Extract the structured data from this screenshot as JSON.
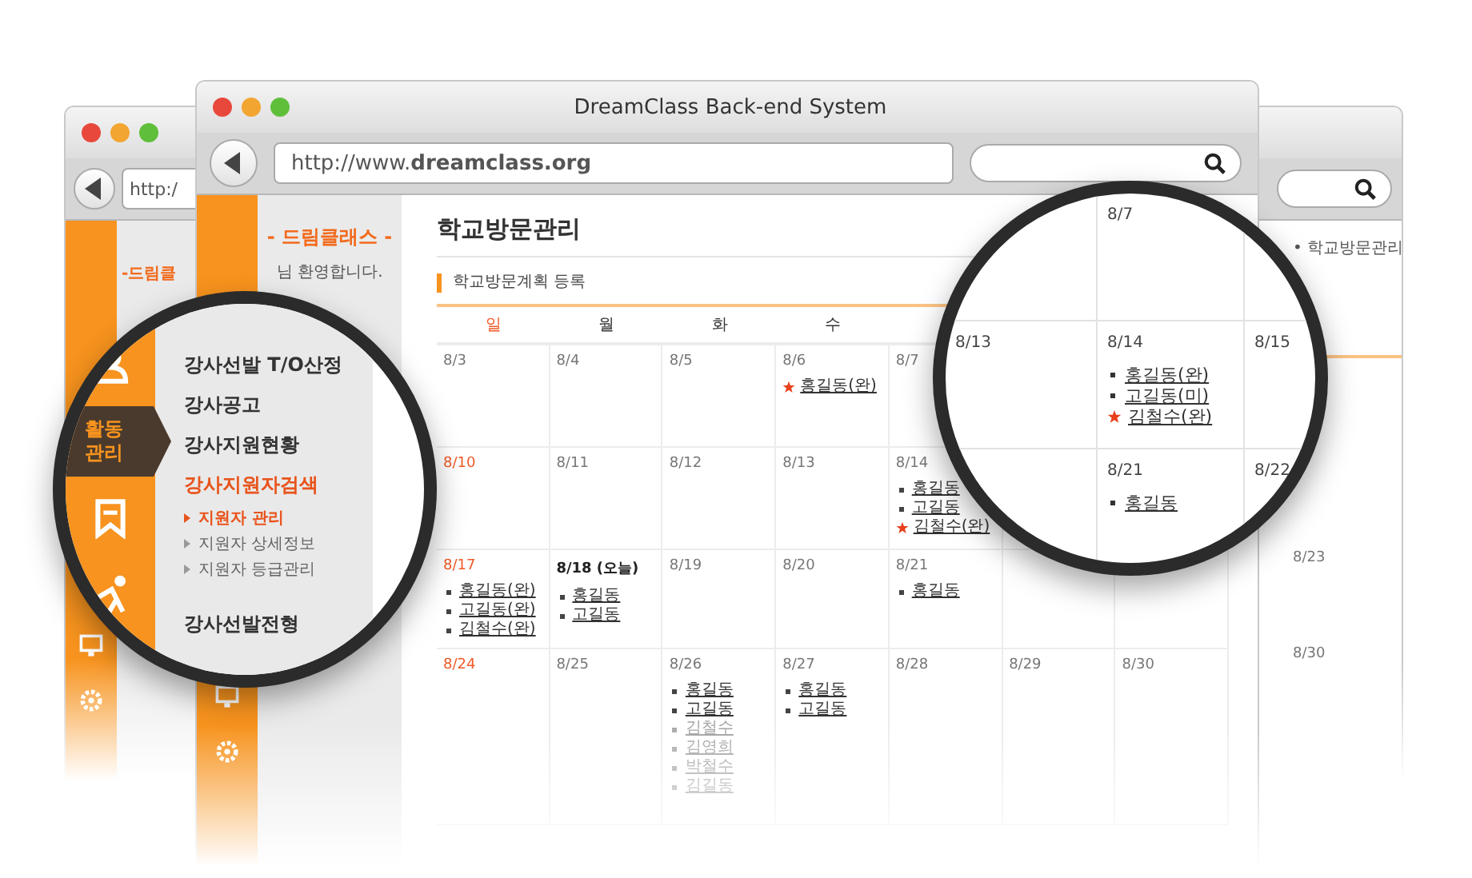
{
  "back_windows": {
    "left": {
      "url": "http:/",
      "logo": "-드림클"
    },
    "right": {
      "breadcrumb": "• 학교방문관리",
      "dates": [
        "8/23",
        "8/30"
      ]
    }
  },
  "window": {
    "title": "DreamClass Back-end System",
    "url": "http://www.**dreamclass.org**"
  },
  "sidebar": {
    "logo": "- 드림클래스 -",
    "welcome": "님 환영합니다."
  },
  "page": {
    "title": "학교방문관리",
    "section": "학교방문계획 등록"
  },
  "calendar": {
    "weekdays": [
      {
        "label": "일",
        "kind": "holiday"
      },
      {
        "label": "월",
        "kind": "normal"
      },
      {
        "label": "화",
        "kind": "normal"
      },
      {
        "label": "수",
        "kind": "normal"
      }
    ],
    "weeks": [
      [
        {
          "date": "8/3",
          "kind": "normal"
        },
        {
          "date": "8/4",
          "kind": "normal"
        },
        {
          "date": "8/5",
          "kind": "normal"
        },
        {
          "date": "8/6",
          "kind": "normal",
          "entries": [
            {
              "name": "홍길동(완)",
              "kind": "star"
            }
          ]
        },
        {
          "date": "8/7",
          "kind": "normal"
        }
      ],
      [
        {
          "date": "8/10",
          "kind": "holiday"
        },
        {
          "date": "8/11",
          "kind": "normal"
        },
        {
          "date": "8/12",
          "kind": "normal"
        },
        {
          "date": "8/13",
          "kind": "normal"
        },
        {
          "date": "8/14",
          "kind": "normal",
          "entries": [
            {
              "name": "홍길동",
              "kind": "plain"
            },
            {
              "name": "고길동",
              "kind": "plain"
            },
            {
              "name": "김철수(완)",
              "kind": "star"
            }
          ]
        }
      ],
      [
        {
          "date": "8/17",
          "kind": "holiday",
          "entries": [
            {
              "name": "홍길동(완)",
              "kind": "plain"
            },
            {
              "name": "고길동(완)",
              "kind": "plain"
            },
            {
              "name": "김철수(완)",
              "kind": "plain"
            }
          ]
        },
        {
          "date": "8/18 (오늘)",
          "kind": "today",
          "entries": [
            {
              "name": "홍길동",
              "kind": "plain"
            },
            {
              "name": "고길동",
              "kind": "plain"
            }
          ]
        },
        {
          "date": "8/19",
          "kind": "normal"
        },
        {
          "date": "8/20",
          "kind": "normal"
        },
        {
          "date": "8/21",
          "kind": "normal",
          "entries": [
            {
              "name": "홍길동",
              "kind": "plain"
            }
          ]
        }
      ],
      [
        {
          "date": "8/24",
          "kind": "holiday"
        },
        {
          "date": "8/25",
          "kind": "normal"
        },
        {
          "date": "8/26",
          "kind": "normal",
          "entries": [
            {
              "name": "홍길동",
              "kind": "plain"
            },
            {
              "name": "고길동",
              "kind": "plain"
            },
            {
              "name": "김철수",
              "kind": "faded"
            },
            {
              "name": "김영희",
              "kind": "faded"
            },
            {
              "name": "박철수",
              "kind": "faded"
            },
            {
              "name": "김길동",
              "kind": "faded"
            }
          ]
        },
        {
          "date": "8/27",
          "kind": "normal",
          "entries": [
            {
              "name": "홍길동",
              "kind": "plain"
            },
            {
              "name": "고길동",
              "kind": "plain"
            }
          ]
        },
        {
          "date": "8/28",
          "kind": "normal"
        },
        {
          "date": "8/29",
          "kind": "normal"
        },
        {
          "date": "8/30",
          "kind": "normal"
        }
      ]
    ]
  },
  "magnifier_left": {
    "nav": [
      {
        "selected": false
      },
      {
        "label": "활동\n관리",
        "selected": true
      },
      {
        "selected": false
      },
      {
        "selected": false
      }
    ],
    "menu": [
      {
        "label": "강사선발 T/O산정",
        "selected": false
      },
      {
        "label": "강사공고",
        "selected": false
      },
      {
        "label": "강사지원현황",
        "selected": false
      },
      {
        "label": "강사지원자검색",
        "selected": true,
        "children": [
          {
            "label": "지원자 관리",
            "selected": true
          },
          {
            "label": "지원자 상세정보",
            "selected": false
          },
          {
            "label": "지원자 등급관리",
            "selected": false
          }
        ]
      },
      {
        "label": "강사선발전형",
        "selected": false
      }
    ]
  },
  "magnifier_right": {
    "weeks": [
      [
        {
          "date": "8/7"
        }
      ],
      [
        {
          "date": "8/13"
        },
        {
          "date": "8/14",
          "entries": [
            {
              "name": "홍길동(완)",
              "kind": "plain"
            },
            {
              "name": "고길동(미)",
              "kind": "plain"
            },
            {
              "name": "김철수(완)",
              "kind": "star"
            }
          ]
        },
        {
          "date": "8/15"
        }
      ],
      [
        {
          "date": "8/21",
          "entries": [
            {
              "name": "홍길동",
              "kind": "plain"
            }
          ]
        },
        {
          "date": "8/22"
        }
      ]
    ]
  }
}
